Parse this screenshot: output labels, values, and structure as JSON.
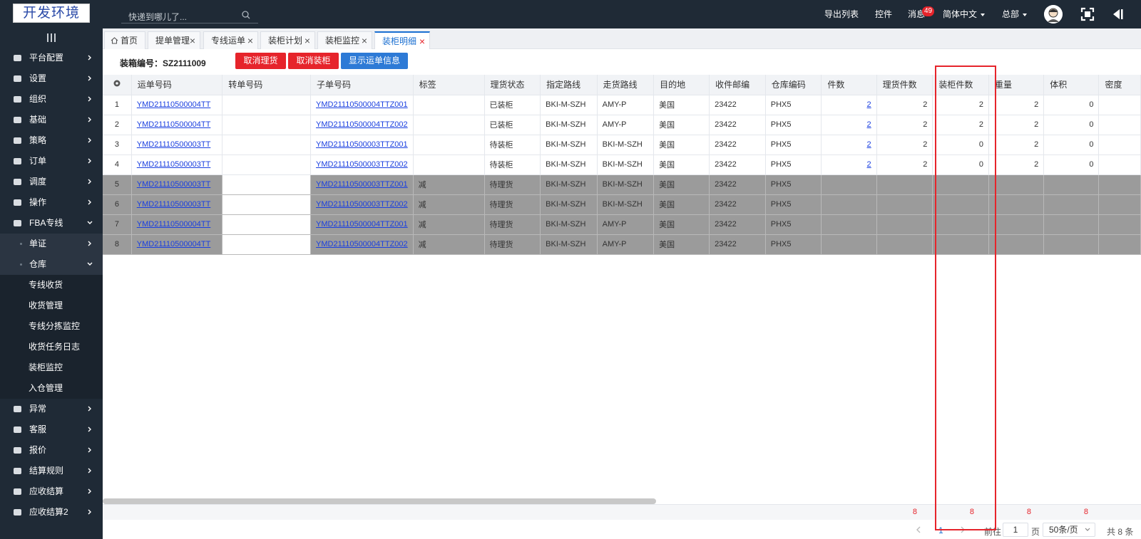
{
  "header": {
    "logo_text": "开发环境",
    "search_placeholder": "快递到哪儿了...",
    "nav": {
      "export_list": "导出列表",
      "widgets": "控件",
      "messages": "消息",
      "message_count": "49",
      "language": "简体中文",
      "org": "总部"
    }
  },
  "sidebar": {
    "items": [
      {
        "label": "平台配置"
      },
      {
        "label": "设置"
      },
      {
        "label": "组织"
      },
      {
        "label": "基础"
      },
      {
        "label": "策略"
      },
      {
        "label": "订单"
      },
      {
        "label": "调度"
      },
      {
        "label": "操作"
      },
      {
        "label": "FBA专线"
      }
    ],
    "sub_items": [
      {
        "label": "单证"
      },
      {
        "label": "仓库"
      }
    ],
    "leaf_items": [
      {
        "label": "专线收货"
      },
      {
        "label": "收货管理"
      },
      {
        "label": "专线分拣监控"
      },
      {
        "label": "收货任务日志"
      },
      {
        "label": "装柜监控"
      },
      {
        "label": "入仓管理"
      }
    ],
    "bottom_items": [
      {
        "label": "异常"
      },
      {
        "label": "客服"
      },
      {
        "label": "报价"
      },
      {
        "label": "结算规则"
      },
      {
        "label": "应收结算"
      },
      {
        "label": "应收结算2"
      }
    ]
  },
  "tabs": [
    {
      "label": "首页"
    },
    {
      "label": "提单管理"
    },
    {
      "label": "专线运单"
    },
    {
      "label": "装柜计划"
    },
    {
      "label": "装柜监控"
    },
    {
      "label": "装柜明细"
    }
  ],
  "toolbar": {
    "box_number": "装箱编号：SZ2111009",
    "cancel_sorting": "取消理货",
    "cancel_loading": "取消装柜",
    "show_waybill": "显示运单信息"
  },
  "table": {
    "columns": [
      "运单号码",
      "转单号码",
      "子单号码",
      "标签",
      "理货状态",
      "指定路线",
      "走货路线",
      "目的地",
      "收件邮编",
      "仓库编码",
      "件数",
      "理货件数",
      "装柜件数",
      "重量",
      "体积",
      "密度"
    ],
    "rows": [
      {
        "idx": "1",
        "waybill": "YMD21110500004TT",
        "transfer": "",
        "sub": "YMD21110500004TTZ001",
        "tag": "",
        "status": "已装柜",
        "route": "BKI-M-SZH",
        "ship_route": "AMY-P",
        "dest": "美国",
        "zip": "23422",
        "wh": "PHX5",
        "pieces": "2",
        "sorted": "2",
        "loaded": "2",
        "weight": "2",
        "volume": "0",
        "density": "",
        "gray": false
      },
      {
        "idx": "2",
        "waybill": "YMD21110500004TT",
        "transfer": "",
        "sub": "YMD21110500004TTZ002",
        "tag": "",
        "status": "已装柜",
        "route": "BKI-M-SZH",
        "ship_route": "AMY-P",
        "dest": "美国",
        "zip": "23422",
        "wh": "PHX5",
        "pieces": "2",
        "sorted": "2",
        "loaded": "2",
        "weight": "2",
        "volume": "0",
        "density": "",
        "gray": false
      },
      {
        "idx": "3",
        "waybill": "YMD21110500003TT",
        "transfer": "",
        "sub": "YMD21110500003TTZ001",
        "tag": "",
        "status": "待装柜",
        "route": "BKI-M-SZH",
        "ship_route": "BKI-M-SZH",
        "dest": "美国",
        "zip": "23422",
        "wh": "PHX5",
        "pieces": "2",
        "sorted": "2",
        "loaded": "0",
        "weight": "2",
        "volume": "0",
        "density": "",
        "gray": false
      },
      {
        "idx": "4",
        "waybill": "YMD21110500003TT",
        "transfer": "",
        "sub": "YMD21110500003TTZ002",
        "tag": "",
        "status": "待装柜",
        "route": "BKI-M-SZH",
        "ship_route": "BKI-M-SZH",
        "dest": "美国",
        "zip": "23422",
        "wh": "PHX5",
        "pieces": "2",
        "sorted": "2",
        "loaded": "0",
        "weight": "2",
        "volume": "0",
        "density": "",
        "gray": false
      },
      {
        "idx": "5",
        "waybill": "YMD21110500003TT",
        "transfer": "",
        "sub": "YMD21110500003TTZ001",
        "tag": "减",
        "status": "待理货",
        "route": "BKI-M-SZH",
        "ship_route": "BKI-M-SZH",
        "dest": "美国",
        "zip": "23422",
        "wh": "PHX5",
        "pieces": "",
        "sorted": "",
        "loaded": "",
        "weight": "",
        "volume": "",
        "density": "",
        "gray": true
      },
      {
        "idx": "6",
        "waybill": "YMD21110500003TT",
        "transfer": "",
        "sub": "YMD21110500003TTZ002",
        "tag": "减",
        "status": "待理货",
        "route": "BKI-M-SZH",
        "ship_route": "BKI-M-SZH",
        "dest": "美国",
        "zip": "23422",
        "wh": "PHX5",
        "pieces": "",
        "sorted": "",
        "loaded": "",
        "weight": "",
        "volume": "",
        "density": "",
        "gray": true
      },
      {
        "idx": "7",
        "waybill": "YMD21110500004TT",
        "transfer": "",
        "sub": "YMD21110500004TTZ001",
        "tag": "减",
        "status": "待理货",
        "route": "BKI-M-SZH",
        "ship_route": "AMY-P",
        "dest": "美国",
        "zip": "23422",
        "wh": "PHX5",
        "pieces": "",
        "sorted": "",
        "loaded": "",
        "weight": "",
        "volume": "",
        "density": "",
        "gray": true
      },
      {
        "idx": "8",
        "waybill": "YMD21110500004TT",
        "transfer": "",
        "sub": "YMD21110500004TTZ002",
        "tag": "减",
        "status": "待理货",
        "route": "BKI-M-SZH",
        "ship_route": "AMY-P",
        "dest": "美国",
        "zip": "23422",
        "wh": "PHX5",
        "pieces": "",
        "sorted": "",
        "loaded": "",
        "weight": "",
        "volume": "",
        "density": "",
        "gray": true
      }
    ],
    "sums": {
      "pieces": "8",
      "sorted": "8",
      "loaded": "8",
      "weight": "8",
      "volume": "0"
    }
  },
  "pagination": {
    "current_page": "1",
    "goto_label": "前往",
    "goto_value": "1",
    "page_label": "页",
    "page_size": "50条/页",
    "total": "共 8 条"
  },
  "colors": {
    "accent": "#1a6fd1",
    "danger": "#e6242b",
    "sidebar": "#1f2a36"
  }
}
